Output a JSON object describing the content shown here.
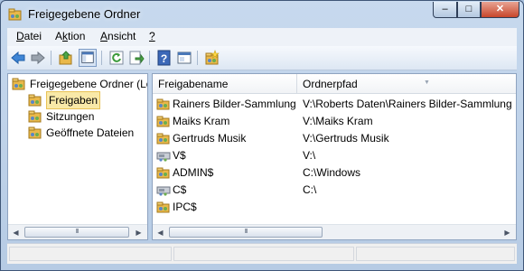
{
  "window": {
    "title": "Freigegebene Ordner",
    "controls": {
      "minimize": "–",
      "maximize": "□",
      "close": "✕"
    }
  },
  "menu": [
    {
      "label": "Datei",
      "mnemonic": "D"
    },
    {
      "label": "Aktion",
      "mnemonic": "k"
    },
    {
      "label": "Ansicht",
      "mnemonic": "A"
    },
    {
      "label": "?",
      "mnemonic": "?"
    }
  ],
  "toolbar": {
    "icons": [
      "back-icon",
      "forward-icon",
      "up-folder-icon",
      "show-hide-tree-icon",
      "refresh-icon",
      "export-list-icon",
      "help-icon",
      "properties-icon",
      "new-share-icon"
    ]
  },
  "tree": {
    "root": "Freigegebene Ordner (Lo",
    "items": [
      {
        "label": "Freigaben",
        "selected": true
      },
      {
        "label": "Sitzungen",
        "selected": false
      },
      {
        "label": "Geöffnete Dateien",
        "selected": false
      }
    ]
  },
  "list": {
    "headers": {
      "name": "Freigabename",
      "path": "Ordnerpfad"
    },
    "rows": [
      {
        "name": "Rainers Bilder-Sammlung",
        "path": "V:\\Roberts Daten\\Rainers Bilder-Sammlung",
        "icon": "shared-folder-icon"
      },
      {
        "name": "Maiks Kram",
        "path": "V:\\Maiks Kram",
        "icon": "shared-folder-icon"
      },
      {
        "name": "Gertruds Musik",
        "path": "V:\\Gertruds Musik",
        "icon": "shared-folder-icon"
      },
      {
        "name": "V$",
        "path": "V:\\",
        "icon": "shared-drive-icon"
      },
      {
        "name": "ADMIN$",
        "path": "C:\\Windows",
        "icon": "shared-folder-icon"
      },
      {
        "name": "C$",
        "path": "C:\\",
        "icon": "shared-drive-icon"
      },
      {
        "name": "IPC$",
        "path": "",
        "icon": "shared-folder-icon"
      }
    ]
  },
  "scrollbar": {
    "thumb_grip": "III"
  },
  "colors": {
    "selection_bg": "#f9e9a8",
    "folder": "#e9b84a",
    "window_frame": "#b6cbe4"
  }
}
